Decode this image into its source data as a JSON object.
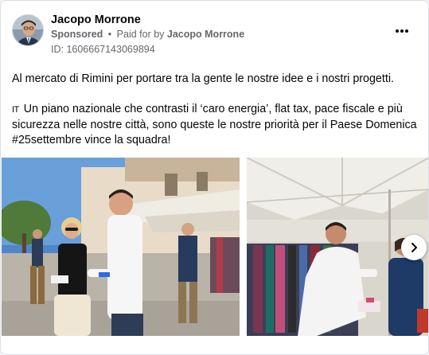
{
  "post": {
    "author": "Jacopo Morrone",
    "sponsored": "Sponsored",
    "separator": "•",
    "paid_for_prefix": "Paid for by",
    "paid_for_by": "Jacopo Morrone",
    "ad_id": "ID: 1606667143069894",
    "more_options_icon": "more-horizontal-icon",
    "paragraph_1": "Al mercato di Rimini per portare tra la gente le nostre idee e i nostri progetti.",
    "flag_icon": "IT",
    "paragraph_2": "Un piano nazionale che contrasti il ‘caro energia’, flat tax, pace fiscale e più sicurezza nelle nostre città, sono queste le nostre priorità per il Paese Domenica #25settembre vince la squadra!"
  },
  "carousel": {
    "next_icon": "chevron-right-icon",
    "photos": [
      {
        "subject": "market-street-photo"
      },
      {
        "subject": "clothing-stall-photo"
      }
    ]
  },
  "colors": {
    "text_primary": "#050505",
    "text_secondary": "#65676b",
    "card_border": "#dddfe2"
  }
}
